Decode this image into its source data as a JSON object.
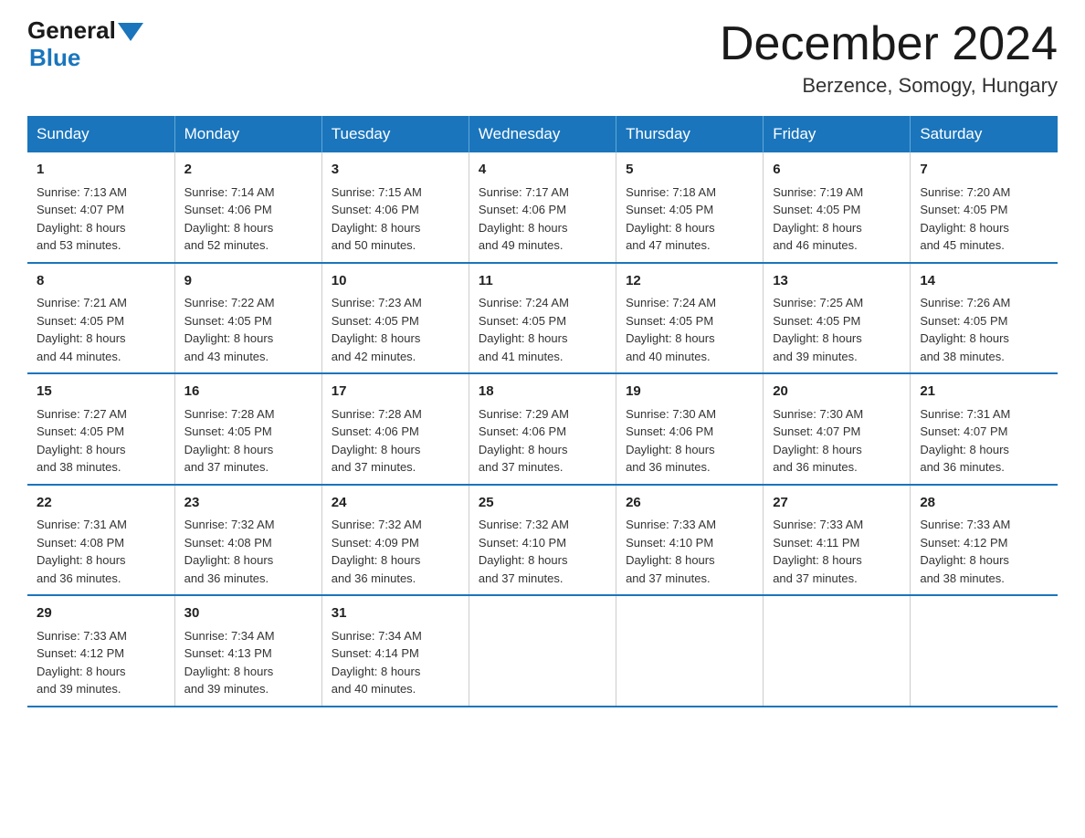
{
  "logo": {
    "general": "General",
    "blue": "Blue"
  },
  "title": "December 2024",
  "location": "Berzence, Somogy, Hungary",
  "headers": [
    "Sunday",
    "Monday",
    "Tuesday",
    "Wednesday",
    "Thursday",
    "Friday",
    "Saturday"
  ],
  "weeks": [
    [
      {
        "day": "1",
        "sunrise": "7:13 AM",
        "sunset": "4:07 PM",
        "daylight": "8 hours and 53 minutes."
      },
      {
        "day": "2",
        "sunrise": "7:14 AM",
        "sunset": "4:06 PM",
        "daylight": "8 hours and 52 minutes."
      },
      {
        "day": "3",
        "sunrise": "7:15 AM",
        "sunset": "4:06 PM",
        "daylight": "8 hours and 50 minutes."
      },
      {
        "day": "4",
        "sunrise": "7:17 AM",
        "sunset": "4:06 PM",
        "daylight": "8 hours and 49 minutes."
      },
      {
        "day": "5",
        "sunrise": "7:18 AM",
        "sunset": "4:05 PM",
        "daylight": "8 hours and 47 minutes."
      },
      {
        "day": "6",
        "sunrise": "7:19 AM",
        "sunset": "4:05 PM",
        "daylight": "8 hours and 46 minutes."
      },
      {
        "day": "7",
        "sunrise": "7:20 AM",
        "sunset": "4:05 PM",
        "daylight": "8 hours and 45 minutes."
      }
    ],
    [
      {
        "day": "8",
        "sunrise": "7:21 AM",
        "sunset": "4:05 PM",
        "daylight": "8 hours and 44 minutes."
      },
      {
        "day": "9",
        "sunrise": "7:22 AM",
        "sunset": "4:05 PM",
        "daylight": "8 hours and 43 minutes."
      },
      {
        "day": "10",
        "sunrise": "7:23 AM",
        "sunset": "4:05 PM",
        "daylight": "8 hours and 42 minutes."
      },
      {
        "day": "11",
        "sunrise": "7:24 AM",
        "sunset": "4:05 PM",
        "daylight": "8 hours and 41 minutes."
      },
      {
        "day": "12",
        "sunrise": "7:24 AM",
        "sunset": "4:05 PM",
        "daylight": "8 hours and 40 minutes."
      },
      {
        "day": "13",
        "sunrise": "7:25 AM",
        "sunset": "4:05 PM",
        "daylight": "8 hours and 39 minutes."
      },
      {
        "day": "14",
        "sunrise": "7:26 AM",
        "sunset": "4:05 PM",
        "daylight": "8 hours and 38 minutes."
      }
    ],
    [
      {
        "day": "15",
        "sunrise": "7:27 AM",
        "sunset": "4:05 PM",
        "daylight": "8 hours and 38 minutes."
      },
      {
        "day": "16",
        "sunrise": "7:28 AM",
        "sunset": "4:05 PM",
        "daylight": "8 hours and 37 minutes."
      },
      {
        "day": "17",
        "sunrise": "7:28 AM",
        "sunset": "4:06 PM",
        "daylight": "8 hours and 37 minutes."
      },
      {
        "day": "18",
        "sunrise": "7:29 AM",
        "sunset": "4:06 PM",
        "daylight": "8 hours and 37 minutes."
      },
      {
        "day": "19",
        "sunrise": "7:30 AM",
        "sunset": "4:06 PM",
        "daylight": "8 hours and 36 minutes."
      },
      {
        "day": "20",
        "sunrise": "7:30 AM",
        "sunset": "4:07 PM",
        "daylight": "8 hours and 36 minutes."
      },
      {
        "day": "21",
        "sunrise": "7:31 AM",
        "sunset": "4:07 PM",
        "daylight": "8 hours and 36 minutes."
      }
    ],
    [
      {
        "day": "22",
        "sunrise": "7:31 AM",
        "sunset": "4:08 PM",
        "daylight": "8 hours and 36 minutes."
      },
      {
        "day": "23",
        "sunrise": "7:32 AM",
        "sunset": "4:08 PM",
        "daylight": "8 hours and 36 minutes."
      },
      {
        "day": "24",
        "sunrise": "7:32 AM",
        "sunset": "4:09 PM",
        "daylight": "8 hours and 36 minutes."
      },
      {
        "day": "25",
        "sunrise": "7:32 AM",
        "sunset": "4:10 PM",
        "daylight": "8 hours and 37 minutes."
      },
      {
        "day": "26",
        "sunrise": "7:33 AM",
        "sunset": "4:10 PM",
        "daylight": "8 hours and 37 minutes."
      },
      {
        "day": "27",
        "sunrise": "7:33 AM",
        "sunset": "4:11 PM",
        "daylight": "8 hours and 37 minutes."
      },
      {
        "day": "28",
        "sunrise": "7:33 AM",
        "sunset": "4:12 PM",
        "daylight": "8 hours and 38 minutes."
      }
    ],
    [
      {
        "day": "29",
        "sunrise": "7:33 AM",
        "sunset": "4:12 PM",
        "daylight": "8 hours and 39 minutes."
      },
      {
        "day": "30",
        "sunrise": "7:34 AM",
        "sunset": "4:13 PM",
        "daylight": "8 hours and 39 minutes."
      },
      {
        "day": "31",
        "sunrise": "7:34 AM",
        "sunset": "4:14 PM",
        "daylight": "8 hours and 40 minutes."
      },
      null,
      null,
      null,
      null
    ]
  ],
  "labels": {
    "sunrise": "Sunrise:",
    "sunset": "Sunset:",
    "daylight": "Daylight:"
  }
}
